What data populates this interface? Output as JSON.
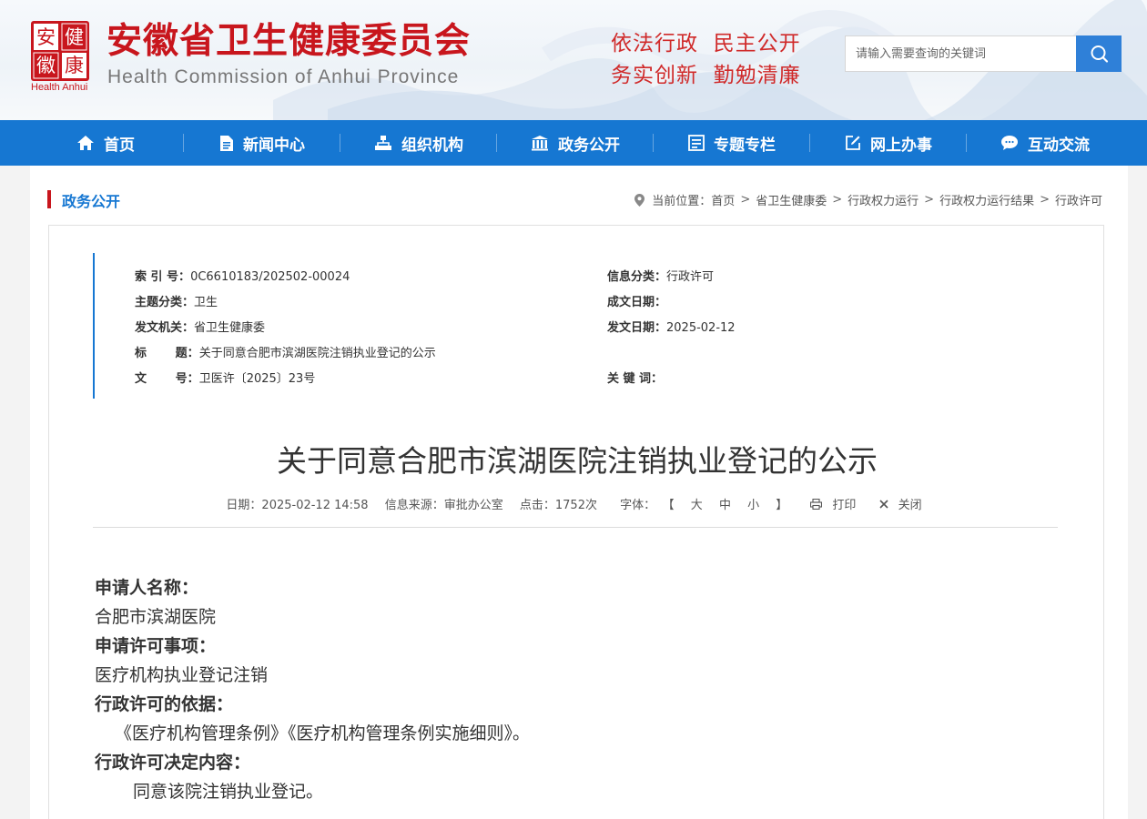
{
  "header": {
    "seal_chars": [
      "安",
      "健",
      "徽",
      "康"
    ],
    "logo_sub": "Health Anhui",
    "site_title": "安徽省卫生健康委员会",
    "site_subtitle": "Health Commission of Anhui Province",
    "slogan_line1": "依法行政  民主公开",
    "slogan_line2": "务实创新  勤勉清廉",
    "search": {
      "placeholder": "请输入需要查询的关键词",
      "button_icon": "search-icon"
    }
  },
  "nav": {
    "items": [
      {
        "label": "首页",
        "icon": "home-icon"
      },
      {
        "label": "新闻中心",
        "icon": "document-icon"
      },
      {
        "label": "组织机构",
        "icon": "org-chart-icon"
      },
      {
        "label": "政务公开",
        "icon": "building-icon"
      },
      {
        "label": "专题专栏",
        "icon": "column-icon"
      },
      {
        "label": "网上办事",
        "icon": "edit-icon"
      },
      {
        "label": "互动交流",
        "icon": "chat-icon"
      }
    ]
  },
  "section": {
    "title": "政务公开",
    "breadcrumb_prefix": "当前位置：",
    "breadcrumb": [
      "首页",
      "省卫生健康委",
      "行政权力运行",
      "行政权力运行结果",
      "行政许可"
    ]
  },
  "meta": {
    "index_label": "索 引 号：",
    "index_value": "0C6610183/202502-00024",
    "category_label": "信息分类：",
    "category_value": "行政许可",
    "topic_label": "主题分类：",
    "topic_value": "卫生",
    "created_label": "成文日期：",
    "created_value": "",
    "issuer_label": "发文机关：",
    "issuer_value": "省卫生健康委",
    "issued_label": "发文日期：",
    "issued_value": "2025-02-12",
    "title_label": "标       题：",
    "title_value": "关于同意合肥市滨湖医院注销执业登记的公示",
    "docno_label": "文       号：",
    "docno_value": "卫医许〔2025〕23号",
    "keywords_label": "关 键 词：",
    "keywords_value": ""
  },
  "article": {
    "title": "关于同意合肥市滨湖医院注销执业登记的公示",
    "date": "日期：2025-02-12 14:58",
    "source": "信息来源：审批办公室",
    "views": "点击：1752次",
    "font_label": "字体：",
    "font_open": "【",
    "font_large": "大",
    "font_medium": "中",
    "font_small": "小",
    "font_close": "】",
    "print": "打印",
    "close": "关闭",
    "paragraphs": [
      {
        "text": "申请人名称：",
        "style": "h"
      },
      {
        "text": "合肥市滨湖医院",
        "style": ""
      },
      {
        "text": "申请许可事项：",
        "style": "h"
      },
      {
        "text": "医疗机构执业登记注销",
        "style": ""
      },
      {
        "text": "行政许可的依据：",
        "style": "h"
      },
      {
        "text": "《医疗机构管理条例》《医疗机构管理条例实施细则》。",
        "style": "i1"
      },
      {
        "text": "行政许可决定内容：",
        "style": "h"
      },
      {
        "text": "同意该院注销执业登记。",
        "style": "i2"
      }
    ]
  },
  "colors": {
    "brand_red": "#c8161d",
    "nav_blue": "#1677d2",
    "search_blue": "#2f80d8"
  }
}
